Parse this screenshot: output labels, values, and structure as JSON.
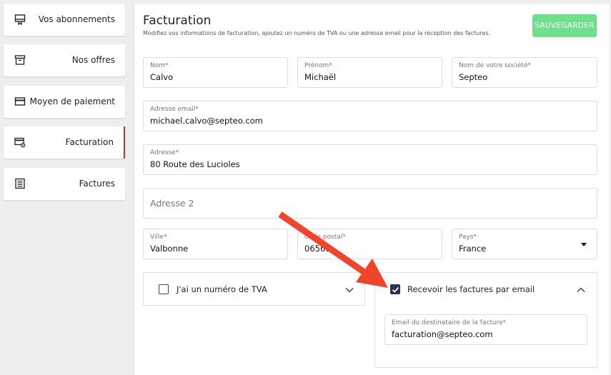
{
  "sidebar": {
    "items": [
      {
        "label": "Vos abonnements",
        "icon": "subscription-icon"
      },
      {
        "label": "Nos offres",
        "icon": "archive-icon"
      },
      {
        "label": "Moyen de paiement",
        "icon": "credit-card-icon"
      },
      {
        "label": "Facturation",
        "icon": "billing-settings-icon",
        "active": true
      },
      {
        "label": "Factures",
        "icon": "invoice-list-icon"
      }
    ]
  },
  "form": {
    "title": "Facturation",
    "subtitle": "Modifiez vos informations de facturation, ajoutez un numéro de TVA ou une adresse email pour la réception des factures.",
    "save_label": "SAUVEGARDER",
    "save_color": "#6ee08a",
    "fields": {
      "nom": {
        "label": "Nom*",
        "value": "Calvo"
      },
      "prenom": {
        "label": "Prénom*",
        "value": "Michaël"
      },
      "societe": {
        "label": "Nom de votre société*",
        "value": "Septeo"
      },
      "email": {
        "label": "Adresse email*",
        "value": "michael.calvo@septeo.com"
      },
      "adresse": {
        "label": "Adresse*",
        "value": "80 Route des Lucioles"
      },
      "adresse2": {
        "placeholder": "Adresse 2"
      },
      "ville": {
        "label": "Ville*",
        "value": "Valbonne"
      },
      "code_postal": {
        "label": "Code postal*",
        "value": "06560"
      },
      "pays": {
        "label": "Pays*",
        "value": "France"
      }
    },
    "tva": {
      "label": "J'ai un numéro de TVA",
      "checked": false
    },
    "email_invoices": {
      "label": "Recevoir les factures par email",
      "checked": true,
      "recipient": {
        "label": "Email du destinataire de la facture*",
        "value": "facturation@septeo.com"
      }
    }
  },
  "annotation": {
    "arrow_color": "#f0452a"
  }
}
